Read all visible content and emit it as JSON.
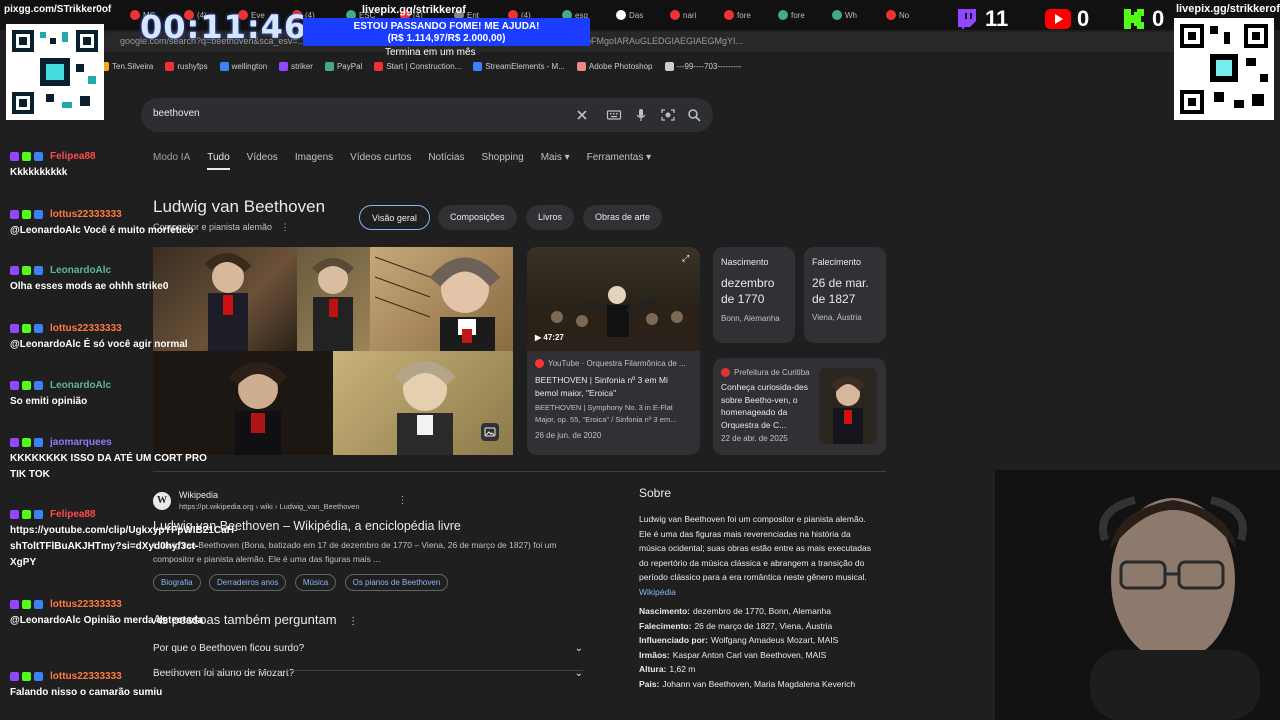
{
  "overlay": {
    "timer": "00:11:46",
    "pixgg_left": "pixgg.com/STrikker0of",
    "pixgg_right": "livepix.gg/strikkerof",
    "livepix_top": "livepix.gg/strikkerof",
    "banner_line1": "ESTOU PASSANDO FOME! ME AJUDA!",
    "banner_line2": "(R$ 1.114,97/R$ 2.000,00)",
    "goal_caption": "Termina em um mês",
    "twitch_count": "11",
    "youtube_count": "0",
    "kick_count": "0"
  },
  "browser": {
    "url": "google.com/search?q=beethoven&sca_esv=...&lcrp=EgZjaHJvbWUqCggCEC4YsQMYgAQyDggAEEUYJxg5GIAEGIoFMgoIARAuGLEDGIAEGIAEGMgYI...",
    "tabs": [
      "MC",
      "(4)",
      "Eve",
      "(4)",
      "ESC",
      "(4)",
      "Ent",
      "(4)",
      "esq",
      "Das",
      "nari",
      "fore",
      "fore",
      "Wh",
      "No"
    ],
    "bookmarks": [
      "Ten.Silveira",
      "rushyfps",
      "wellington",
      "striker",
      "PayPal",
      "Start | Construction...",
      "StreamElements - M...",
      "Adobe Photoshop",
      "---99----703---------"
    ]
  },
  "search": {
    "query": "beethoven",
    "tabs": [
      "Modo IA",
      "Tudo",
      "Vídeos",
      "Imagens",
      "Vídeos curtos",
      "Notícias",
      "Shopping",
      "Mais ▾",
      "Ferramentas ▾"
    ],
    "active_tab": "Tudo"
  },
  "knowledge_panel": {
    "title": "Ludwig van Beethoven",
    "subtitle": "Compositor e pianista alemão",
    "chips": [
      "Visão geral",
      "Composições",
      "Livros",
      "Obras de arte"
    ],
    "video": {
      "duration": "47:27",
      "source": "YouTube · Orquestra Filarmônica de ...",
      "title": "BEETHOVEN | Sinfonia nº 3 em Mi bemol maior, \"Eroica\"",
      "desc": "BEETHOVEN | Symphony No. 3 in E-Flat Major, op. 55, \"Eroica\" / Sinfonia nº 3 em...",
      "date": "26 de jun. de 2020"
    },
    "birth": {
      "label": "Nascimento",
      "value": "dezembro de 1770",
      "place": "Bonn, Alemanha"
    },
    "death": {
      "label": "Falecimento",
      "value": "26 de mar. de 1827",
      "place": "Viena, Áustria"
    },
    "news": {
      "source": "Prefeitura de Curitiba",
      "title": "Conheça curiosida-des sobre Beetho-ven, o homenageado da Orquestra de C...",
      "date": "22 de abr. de 2025"
    }
  },
  "wiki_result": {
    "site": "Wikipedia",
    "url": "https://pt.wikipedia.org › wiki › Ludwig_van_Beethoven",
    "title": "Ludwig van Beethoven – Wikipédia, a enciclopédia livre",
    "snippet": "Ludwig van Beethoven (Bona, batizado em 17 de dezembro de 1770 – Viena, 26 de março de 1827) foi um compositor e pianista alemão. Ele é uma das figuras mais ...",
    "links": [
      "Biografia",
      "Derradeiros anos",
      "Música",
      "Os pianos de Beethoven"
    ]
  },
  "people_also_ask": {
    "title": "As pessoas também perguntam",
    "q1": "Por que o Beethoven ficou surdo?",
    "q2": "Beethoven foi aluno de Mozart?"
  },
  "sobre": {
    "title": "Sobre",
    "text": "Ludwig van Beethoven foi um compositor e pianista alemão. Ele é uma das figuras mais reverenciadas na história da música ocidental; suas obras estão entre as mais executadas do repertório da música clássica e abrangem a transição do período clássico para a era romântica neste gênero musical.",
    "source": "Wikipédia",
    "facts": [
      {
        "k": "Nascimento:",
        "v": "dezembro de 1770, Bonn, Alemanha"
      },
      {
        "k": "Falecimento:",
        "v": "26 de março de 1827, Viena, Áustria"
      },
      {
        "k": "Influenciado por:",
        "v": "Wolfgang Amadeus Mozart, MAIS"
      },
      {
        "k": "Irmãos:",
        "v": "Kaspar Anton Carl van Beethoven, MAIS"
      },
      {
        "k": "Altura:",
        "v": "1,62 m"
      },
      {
        "k": "Pais:",
        "v": "Johann van Beethoven, Maria Magdalena Keverich"
      }
    ]
  },
  "chat": [
    {
      "user": "Felipea88",
      "color": "#ff4b4b",
      "text": "Kkkkkkkkkk"
    },
    {
      "user": "lottus22333333",
      "color": "#ff7a3d",
      "text": "@LeonardoAlc Você é muito morfético"
    },
    {
      "user": "LeonardoAlc",
      "color": "#5fb6a0",
      "text": "Olha esses mods ae ohhh strike0"
    },
    {
      "user": "lottus22333333",
      "color": "#ff7a3d",
      "text": "@LeonardoAlc É só você agir normal"
    },
    {
      "user": "LeonardoAlc",
      "color": "#5fb6a0",
      "text": "So emiti opinião"
    },
    {
      "user": "jaomarquees",
      "color": "#8a7dff",
      "text": "KKKKKKKK ISSO DA ATÉ UM CORT PRO TIK TOK"
    },
    {
      "user": "Felipea88",
      "color": "#ff4b4b",
      "text": "https://youtube.com/clip/UgkxypYFpWIB21CaH-shToltTFlBuAKJHTmy?si=dXyd0hyf3ct-XgPY"
    },
    {
      "user": "lottus22333333",
      "color": "#ff7a3d",
      "text": "@LeonardoAlc Opinião merda detectada"
    },
    {
      "user": "lottus22333333",
      "color": "#ff7a3d",
      "text": "Falando nisso o camarão sumiu"
    }
  ]
}
